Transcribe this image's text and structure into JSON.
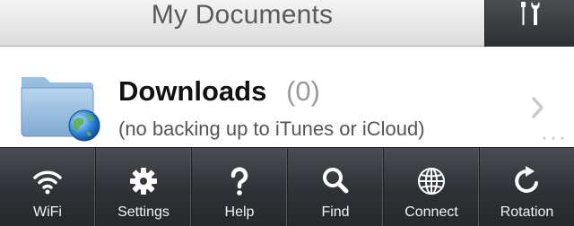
{
  "header": {
    "title": "My Documents",
    "tools_icon": "wrench-screwdriver-icon"
  },
  "folder": {
    "name": "Downloads",
    "count": "(0)",
    "subtitle": "(no backing up to iTunes or iCloud)",
    "icon": "folder-globe-icon"
  },
  "toolbar": {
    "items": [
      {
        "label": "WiFi",
        "icon": "wifi-icon"
      },
      {
        "label": "Settings",
        "icon": "gear-icon"
      },
      {
        "label": "Help",
        "icon": "question-mark-icon"
      },
      {
        "label": "Find",
        "icon": "magnifier-icon"
      },
      {
        "label": "Connect",
        "icon": "globe-icon"
      },
      {
        "label": "Rotation",
        "icon": "rotate-icon"
      }
    ]
  },
  "colors": {
    "toolbar_bg": "#2e3135",
    "header_bg": "#e8e8e8",
    "folder_blue": "#8fb8dc"
  }
}
